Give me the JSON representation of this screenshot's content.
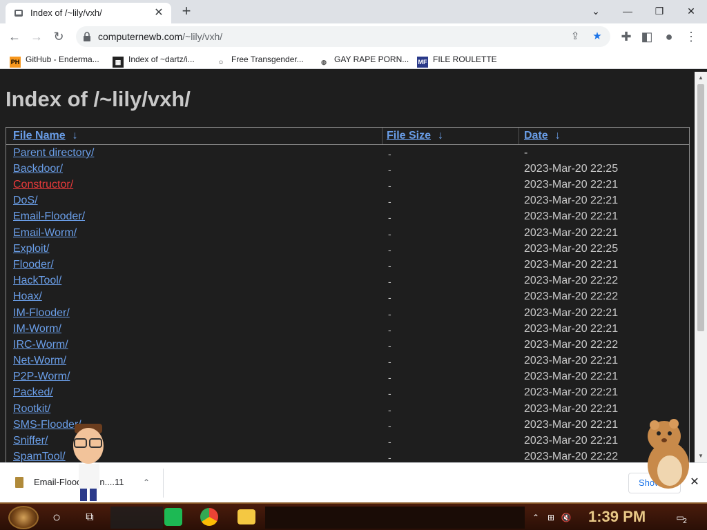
{
  "tab": {
    "title": "Index of /~lily/vxh/",
    "close": "✕",
    "new": "+"
  },
  "window": {
    "minimize": "—",
    "restore": "❐",
    "close": "✕",
    "dropdown": "⌄"
  },
  "nav": {
    "back": "←",
    "forward": "→",
    "reload": "↻"
  },
  "address": {
    "host": "computernewb.com",
    "path": "/~lily/vxh/"
  },
  "bookmarks": [
    {
      "icon": "PH",
      "label": "GitHub - Enderma..."
    },
    {
      "icon": "▦",
      "label": "Index of ~dartz/i..."
    },
    {
      "icon": "☺",
      "label": "Free Transgender..."
    },
    {
      "icon": "◍",
      "label": "GAY RAPE PORN..."
    },
    {
      "icon": "MF",
      "label": "FILE ROULETTE"
    }
  ],
  "page": {
    "heading": "Index of /~lily/vxh/",
    "headers": {
      "name": "File Name",
      "size": "File Size",
      "date": "Date",
      "sort_arrow": "↓"
    },
    "rows": [
      {
        "name": "Parent directory/",
        "size": "-",
        "date": "-"
      },
      {
        "name": "Backdoor/",
        "size": "-",
        "date": "2023-Mar-20 22:25"
      },
      {
        "name": "Constructor/",
        "size": "-",
        "date": "2023-Mar-20 22:21"
      },
      {
        "name": "DoS/",
        "size": "-",
        "date": "2023-Mar-20 22:21"
      },
      {
        "name": "Email-Flooder/",
        "size": "-",
        "date": "2023-Mar-20 22:21"
      },
      {
        "name": "Email-Worm/",
        "size": "-",
        "date": "2023-Mar-20 22:21"
      },
      {
        "name": "Exploit/",
        "size": "-",
        "date": "2023-Mar-20 22:25"
      },
      {
        "name": "Flooder/",
        "size": "-",
        "date": "2023-Mar-20 22:21"
      },
      {
        "name": "HackTool/",
        "size": "-",
        "date": "2023-Mar-20 22:22"
      },
      {
        "name": "Hoax/",
        "size": "-",
        "date": "2023-Mar-20 22:22"
      },
      {
        "name": "IM-Flooder/",
        "size": "-",
        "date": "2023-Mar-20 22:21"
      },
      {
        "name": "IM-Worm/",
        "size": "-",
        "date": "2023-Mar-20 22:21"
      },
      {
        "name": "IRC-Worm/",
        "size": "-",
        "date": "2023-Mar-20 22:22"
      },
      {
        "name": "Net-Worm/",
        "size": "-",
        "date": "2023-Mar-20 22:21"
      },
      {
        "name": "P2P-Worm/",
        "size": "-",
        "date": "2023-Mar-20 22:21"
      },
      {
        "name": "Packed/",
        "size": "-",
        "date": "2023-Mar-20 22:21"
      },
      {
        "name": "Rootkit/",
        "size": "-",
        "date": "2023-Mar-20 22:21"
      },
      {
        "name": "SMS-Flooder/",
        "size": "-",
        "date": "2023-Mar-20 22:21"
      },
      {
        "name": "Sniffer/",
        "size": "-",
        "date": "2023-Mar-20 22:21"
      },
      {
        "name": "SpamTool/",
        "size": "-",
        "date": "2023-Mar-20 22:22"
      }
    ]
  },
  "download": {
    "filename": "Email-Flood...Win....11",
    "show_all": "Show",
    "chevron": "⌃",
    "close": "✕"
  },
  "taskbar": {
    "time": "1:39 PM",
    "notifications": "2"
  },
  "colors": {
    "link": "#6a9ee8",
    "link_active": "#e83a3a",
    "page_bg": "#1e1e1e",
    "text": "#c9c9c9"
  }
}
